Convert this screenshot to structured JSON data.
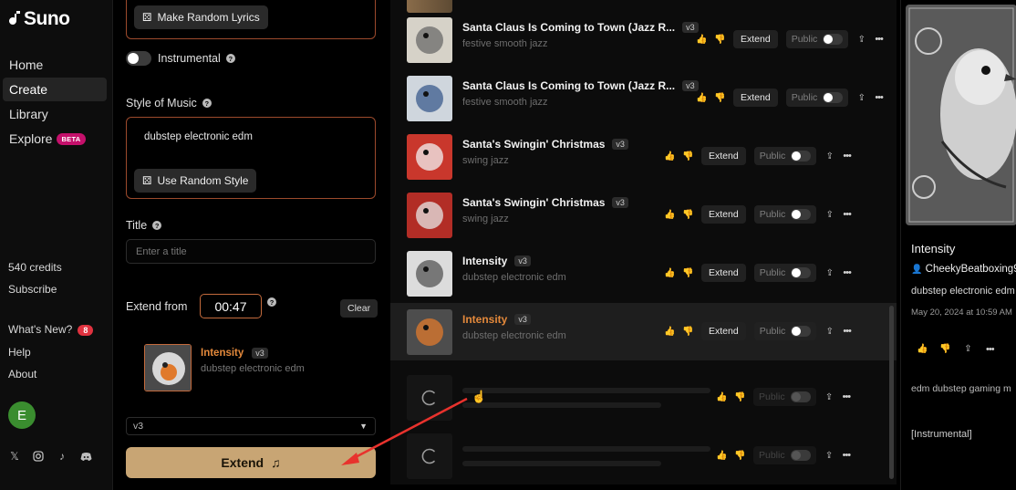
{
  "app": {
    "name": "Suno"
  },
  "nav": [
    {
      "label": "Home"
    },
    {
      "label": "Create"
    },
    {
      "label": "Library"
    },
    {
      "label": "Explore",
      "badge": "BETA"
    }
  ],
  "account": {
    "credits": "540 credits",
    "subscribe": "Subscribe",
    "whats_new": "What's New?",
    "whats_new_count": "8",
    "help": "Help",
    "about": "About",
    "avatar_initial": "E"
  },
  "create": {
    "random_lyrics_label": "Make Random Lyrics",
    "instrumental_label": "Instrumental",
    "instrumental_on": false,
    "style_label": "Style of Music",
    "style_value": "dubstep electronic edm",
    "random_style_label": "Use Random Style",
    "title_label": "Title",
    "title_placeholder": "Enter a title",
    "extend_from_label": "Extend from",
    "extend_from_value": "00:47",
    "clear_label": "Clear",
    "extend_song": {
      "title": "Intensity",
      "version": "v3",
      "style": "dubstep electronic edm"
    },
    "model_version": "v3",
    "extend_button_label": "Extend"
  },
  "songs": [
    {
      "title": "Santa Claus Is Coming to Town (Jazz R...",
      "version": "v3",
      "style": "festive smooth jazz",
      "extend_label": "Extend",
      "public_label": "Public"
    },
    {
      "title": "Santa Claus Is Coming to Town (Jazz R...",
      "version": "v3",
      "style": "festive smooth jazz",
      "extend_label": "Extend",
      "public_label": "Public"
    },
    {
      "title": "Santa's Swingin' Christmas",
      "version": "v3",
      "style": "swing jazz",
      "extend_label": "Extend",
      "public_label": "Public"
    },
    {
      "title": "Santa's Swingin' Christmas",
      "version": "v3",
      "style": "swing jazz",
      "extend_label": "Extend",
      "public_label": "Public"
    },
    {
      "title": "Intensity",
      "version": "v3",
      "style": "dubstep electronic edm",
      "extend_label": "Extend",
      "public_label": "Public"
    },
    {
      "title": "Intensity",
      "version": "v3",
      "style": "dubstep electronic edm",
      "extend_label": "Extend",
      "public_label": "Public",
      "selected": true
    }
  ],
  "pending": [
    {
      "public_label": "Public"
    },
    {
      "public_label": "Public"
    }
  ],
  "detail": {
    "title": "Intensity",
    "user": "CheekyBeatboxing9",
    "style": "dubstep electronic edm",
    "date": "May 20, 2024 at 10:59 AM",
    "tags": "edm dubstep gaming m",
    "lyrics": "[Instrumental]"
  },
  "colors": {
    "accent": "#e4893b",
    "extend_button": "#c8a574",
    "beta_badge": "#c4106b"
  }
}
